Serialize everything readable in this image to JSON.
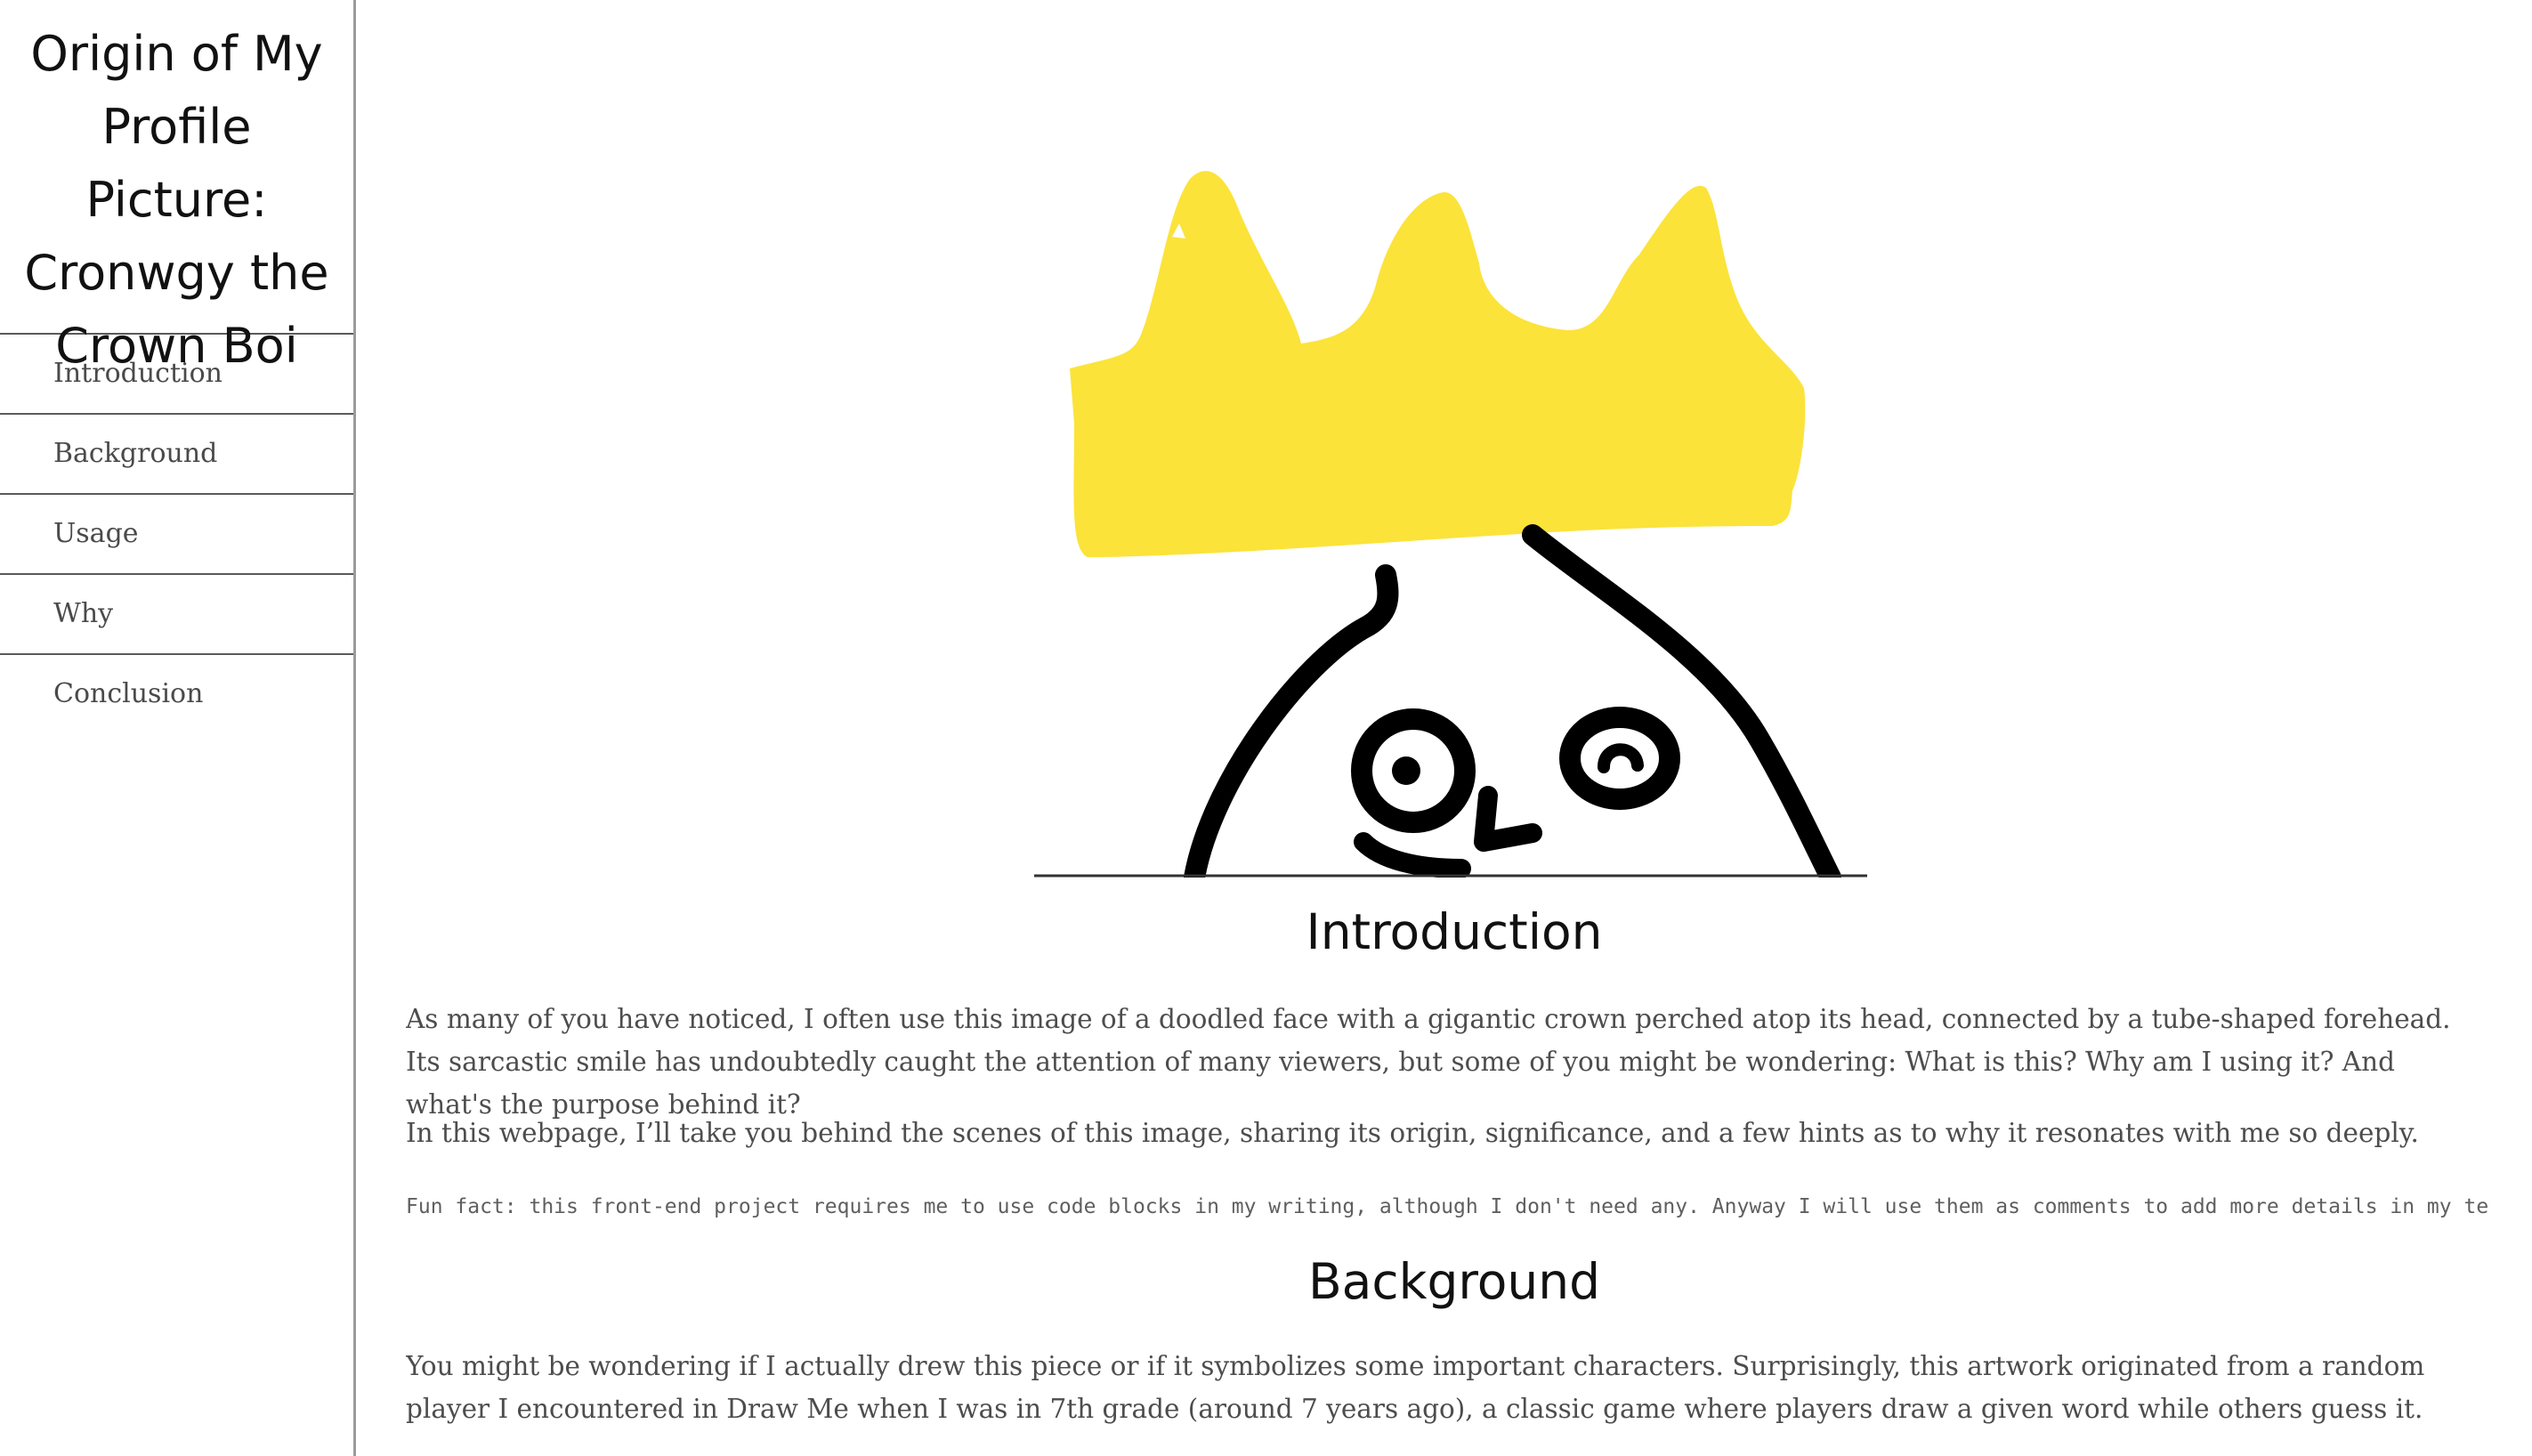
{
  "nav": {
    "title": "Origin of My Profile Picture: Cronwgy the Crown Boi",
    "items": [
      {
        "label": "Introduction"
      },
      {
        "label": "Background"
      },
      {
        "label": "Usage"
      },
      {
        "label": "Why"
      },
      {
        "label": "Conclusion"
      }
    ]
  },
  "hero": {
    "description": "doodled face with a yellow crown",
    "colors": {
      "crown": "#fbe33a",
      "ink": "#000000",
      "divider": "#333333"
    }
  },
  "sections": {
    "introduction": {
      "heading": "Introduction",
      "paragraphs": [
        "As many of you have noticed, I often use this image of a doodled face with a gigantic crown perched atop its head, connected by a tube-shaped forehead. Its sarcastic smile has undoubtedly caught the attention of many viewers, but some of you might be wondering: What is this? Why am I using it? And what's the purpose behind it?",
        "In this webpage, I’ll take you behind the scenes of this image, sharing its origin, significance, and a few hints as to why it resonates with me so deeply."
      ],
      "code_note": "Fun fact: this front-end project requires me to use code blocks in my writing, although I don't need any. Anyway I will use them as comments to add more details in my text."
    },
    "background": {
      "heading": "Background",
      "paragraphs": [
        "You might be wondering if I actually drew this piece or if it symbolizes some important characters. Surprisingly, this artwork originated from a random player I encountered in Draw Me when I was in 7th grade (around 7 years ago), a classic game where players draw a given word while others guess it."
      ]
    }
  }
}
